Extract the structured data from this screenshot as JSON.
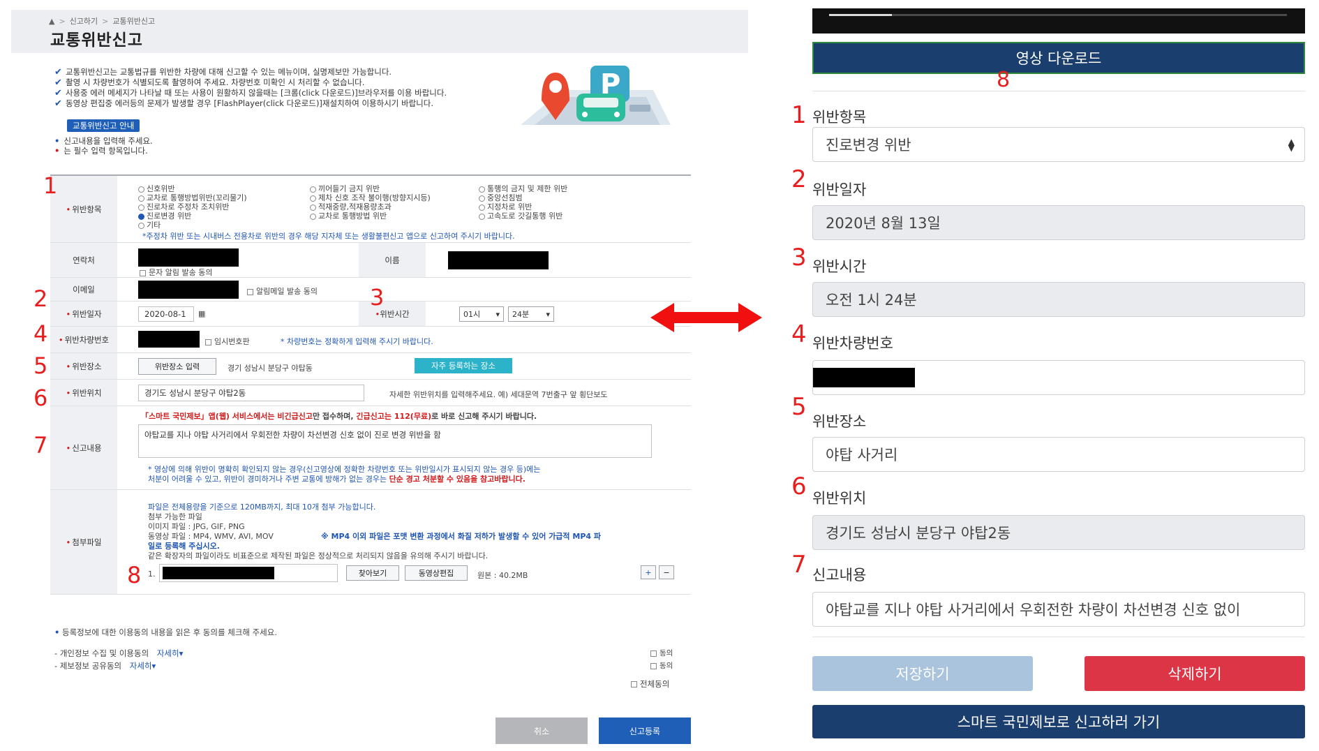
{
  "left": {
    "breadcrumb": [
      "신고하기",
      "교통위반신고"
    ],
    "title": "교통위반신고",
    "notices": [
      "교통위반신고는 교통법규를 위반한 차량에 대해 신고할 수 있는 메뉴이며, 실명제보만 가능합니다.",
      "촬영 시 차량번호가 식별되도록 촬영하여 주세요. 차량번호 미확인 시 처리할 수 없습니다.",
      "사용중 에러 메세지가 나타날 때 또는 사용이 원활하지 않을때는 [크롬(click 다운로드)]브라우저를 이용 바랍니다.",
      "동영상 편집중 에러등의 문제가 발생할 경우 [FlashPlayer(click 다운로드)]재설치하여 이용하시기 바랍니다."
    ],
    "guide_button": "교통위반신고 안내",
    "hint_input": "신고내용을 입력해 주세요.",
    "hint_required": "는 필수 입력 항목입니다.",
    "violation_label": "위반항목",
    "violation_options": [
      [
        "신호위반",
        "끼어들기 금지 위반",
        "통행의 금지 및 제한 위반"
      ],
      [
        "교차로 통행방법위반(꼬리물기)",
        "제차 신호 조작 불이행(방향지시등)",
        "중앙선침범"
      ],
      [
        "진로차로 주정차 조치위반",
        "적재중량,적재용량초과",
        "지정차로 위반"
      ],
      [
        "진로변경 위반",
        "교차로 통행방법 위반",
        "고속도로 갓길통행 위반"
      ],
      [
        "기타",
        "",
        ""
      ]
    ],
    "violation_note": "*주정차 위반 또는 시내버스 전용차로 위반의 경우 해당 지자체 또는 생활불편신고 앱으로 신고하여 주시기 바랍니다.",
    "contact_label": "연락처",
    "sms_consent": "문자 알림 발송 동의",
    "name_label": "이름",
    "email_label": "이메일",
    "email_consent": "알림메일 발송 동의",
    "date_label": "위반일자",
    "date_value": "2020-08-1",
    "time_label": "위반시간",
    "hour_value": "01시",
    "minute_value": "24분",
    "plate_label": "위반차량번호",
    "temp_plate": "임시번호판",
    "plate_note": "* 차량번호는 정확하게 입력해 주시기 바랍니다.",
    "place_label": "위반장소",
    "place_button": "위반장소 입력",
    "place_value": "경기 성남시 분당구 야탑동",
    "frequent_place": "자주 등록하는 장소",
    "location_label": "위반위치",
    "location_value": "경기도 성남시 분당구 야탑2동",
    "location_hint": "자세한 위반위치를 입력해주세요. 예) 세대문역 7번출구 앞 횡단보도",
    "report_label": "신고내용",
    "report_notice_pre": "「스마트 국민제보」앱(웹) 서비스에서는",
    "report_notice_nonurgent": "비긴급신고",
    "report_notice_mid": "만 접수하며,",
    "report_notice_urgent": "긴급신고는 112(무료)",
    "report_notice_post": "로 바로 신고해 주시기 바랍니다.",
    "report_text": "야탑교를 지나 야탑 사거리에서 우회전한 차량이 차선변경 신호 없이 진로 변경 위반을 함",
    "report_warn1": "* 영상에 의해 위반이 명확히 확인되지 않는 경우(신고영상에 정확한 차량번호 또는 위반일시가 표시되지 않는 경우 등)에는",
    "report_warn2_pre": "처분이 어려울 수 있고, 위반이 경미하거나 주변 교통에 방해가 없는 경우는",
    "report_warn2_red": "단순 경고 처분할 수 있음을 참고바랍니다.",
    "attach_label": "첨부파일",
    "attach_lines": [
      "파일은 전체용량을 기준으로 120MB까지, 최대 10개 첨부 가능합니다.",
      "첨부 가능한 파일",
      "이미지 파일 : JPG, GIF, PNG",
      "동영상 파일 : MP4, WMV, AVI, MOV",
      "같은 확장자의 파일이라도 비표준으로 제작된 파일은 정상적으로 처리되지 않음을 유의해 주시기 바랍니다."
    ],
    "attach_mp4_note1": "※ MP4 이외 파일은 포맷 변환 과정에서 화질 저하가 발생할 수 있어 가급적 MP4 파",
    "attach_mp4_note2": "일로 등록해 주십시오.",
    "file_index": "1.",
    "browse_button": "찾아보기",
    "video_edit_button": "동영상편집",
    "file_size": "원본 : 40.2MB",
    "plus": "+",
    "minus": "−",
    "consent_hint": "등록정보에 대한 이용동의 내용을 읽은 후 동의를 체크해 주세요.",
    "consent_items": [
      {
        "label": "개인정보 수집 및 이용동의",
        "more": "자세히"
      },
      {
        "label": "제보정보 공유동의",
        "more": "자세히"
      }
    ],
    "agree": "동의",
    "agree_all": "전체동의",
    "cancel_button": "취소",
    "submit_button": "신고등록"
  },
  "markers": {
    "n1": "1",
    "n2": "2",
    "n3": "3",
    "n4": "4",
    "n5": "5",
    "n6": "6",
    "n7": "7",
    "n8": "8"
  },
  "right": {
    "download_button": "영상 다운로드",
    "fields": [
      {
        "label": "위반항목",
        "value": "진로변경 위반"
      },
      {
        "label": "위반일자",
        "value": "2020년 8월 13일"
      },
      {
        "label": "위반시간",
        "value": "오전 1시 24분"
      },
      {
        "label": "위반차량번호",
        "value": ""
      },
      {
        "label": "위반장소",
        "value": "야탑 사거리"
      },
      {
        "label": "위반위치",
        "value": "경기도 성남시 분당구 야탑2동"
      },
      {
        "label": "신고내용",
        "value": "야탑교를 지나 야탑 사거리에서 우회전한 차량이 차선변경 신호 없이"
      }
    ],
    "save_button": "저장하기",
    "delete_button": "삭제하기",
    "smart_button": "스마트 국민제보로 신고하러 가기"
  },
  "colors": {
    "accent_red": "#e81d1d",
    "navy": "#1a3f6e",
    "blue": "#1f5fb8",
    "danger": "#dc3545"
  }
}
